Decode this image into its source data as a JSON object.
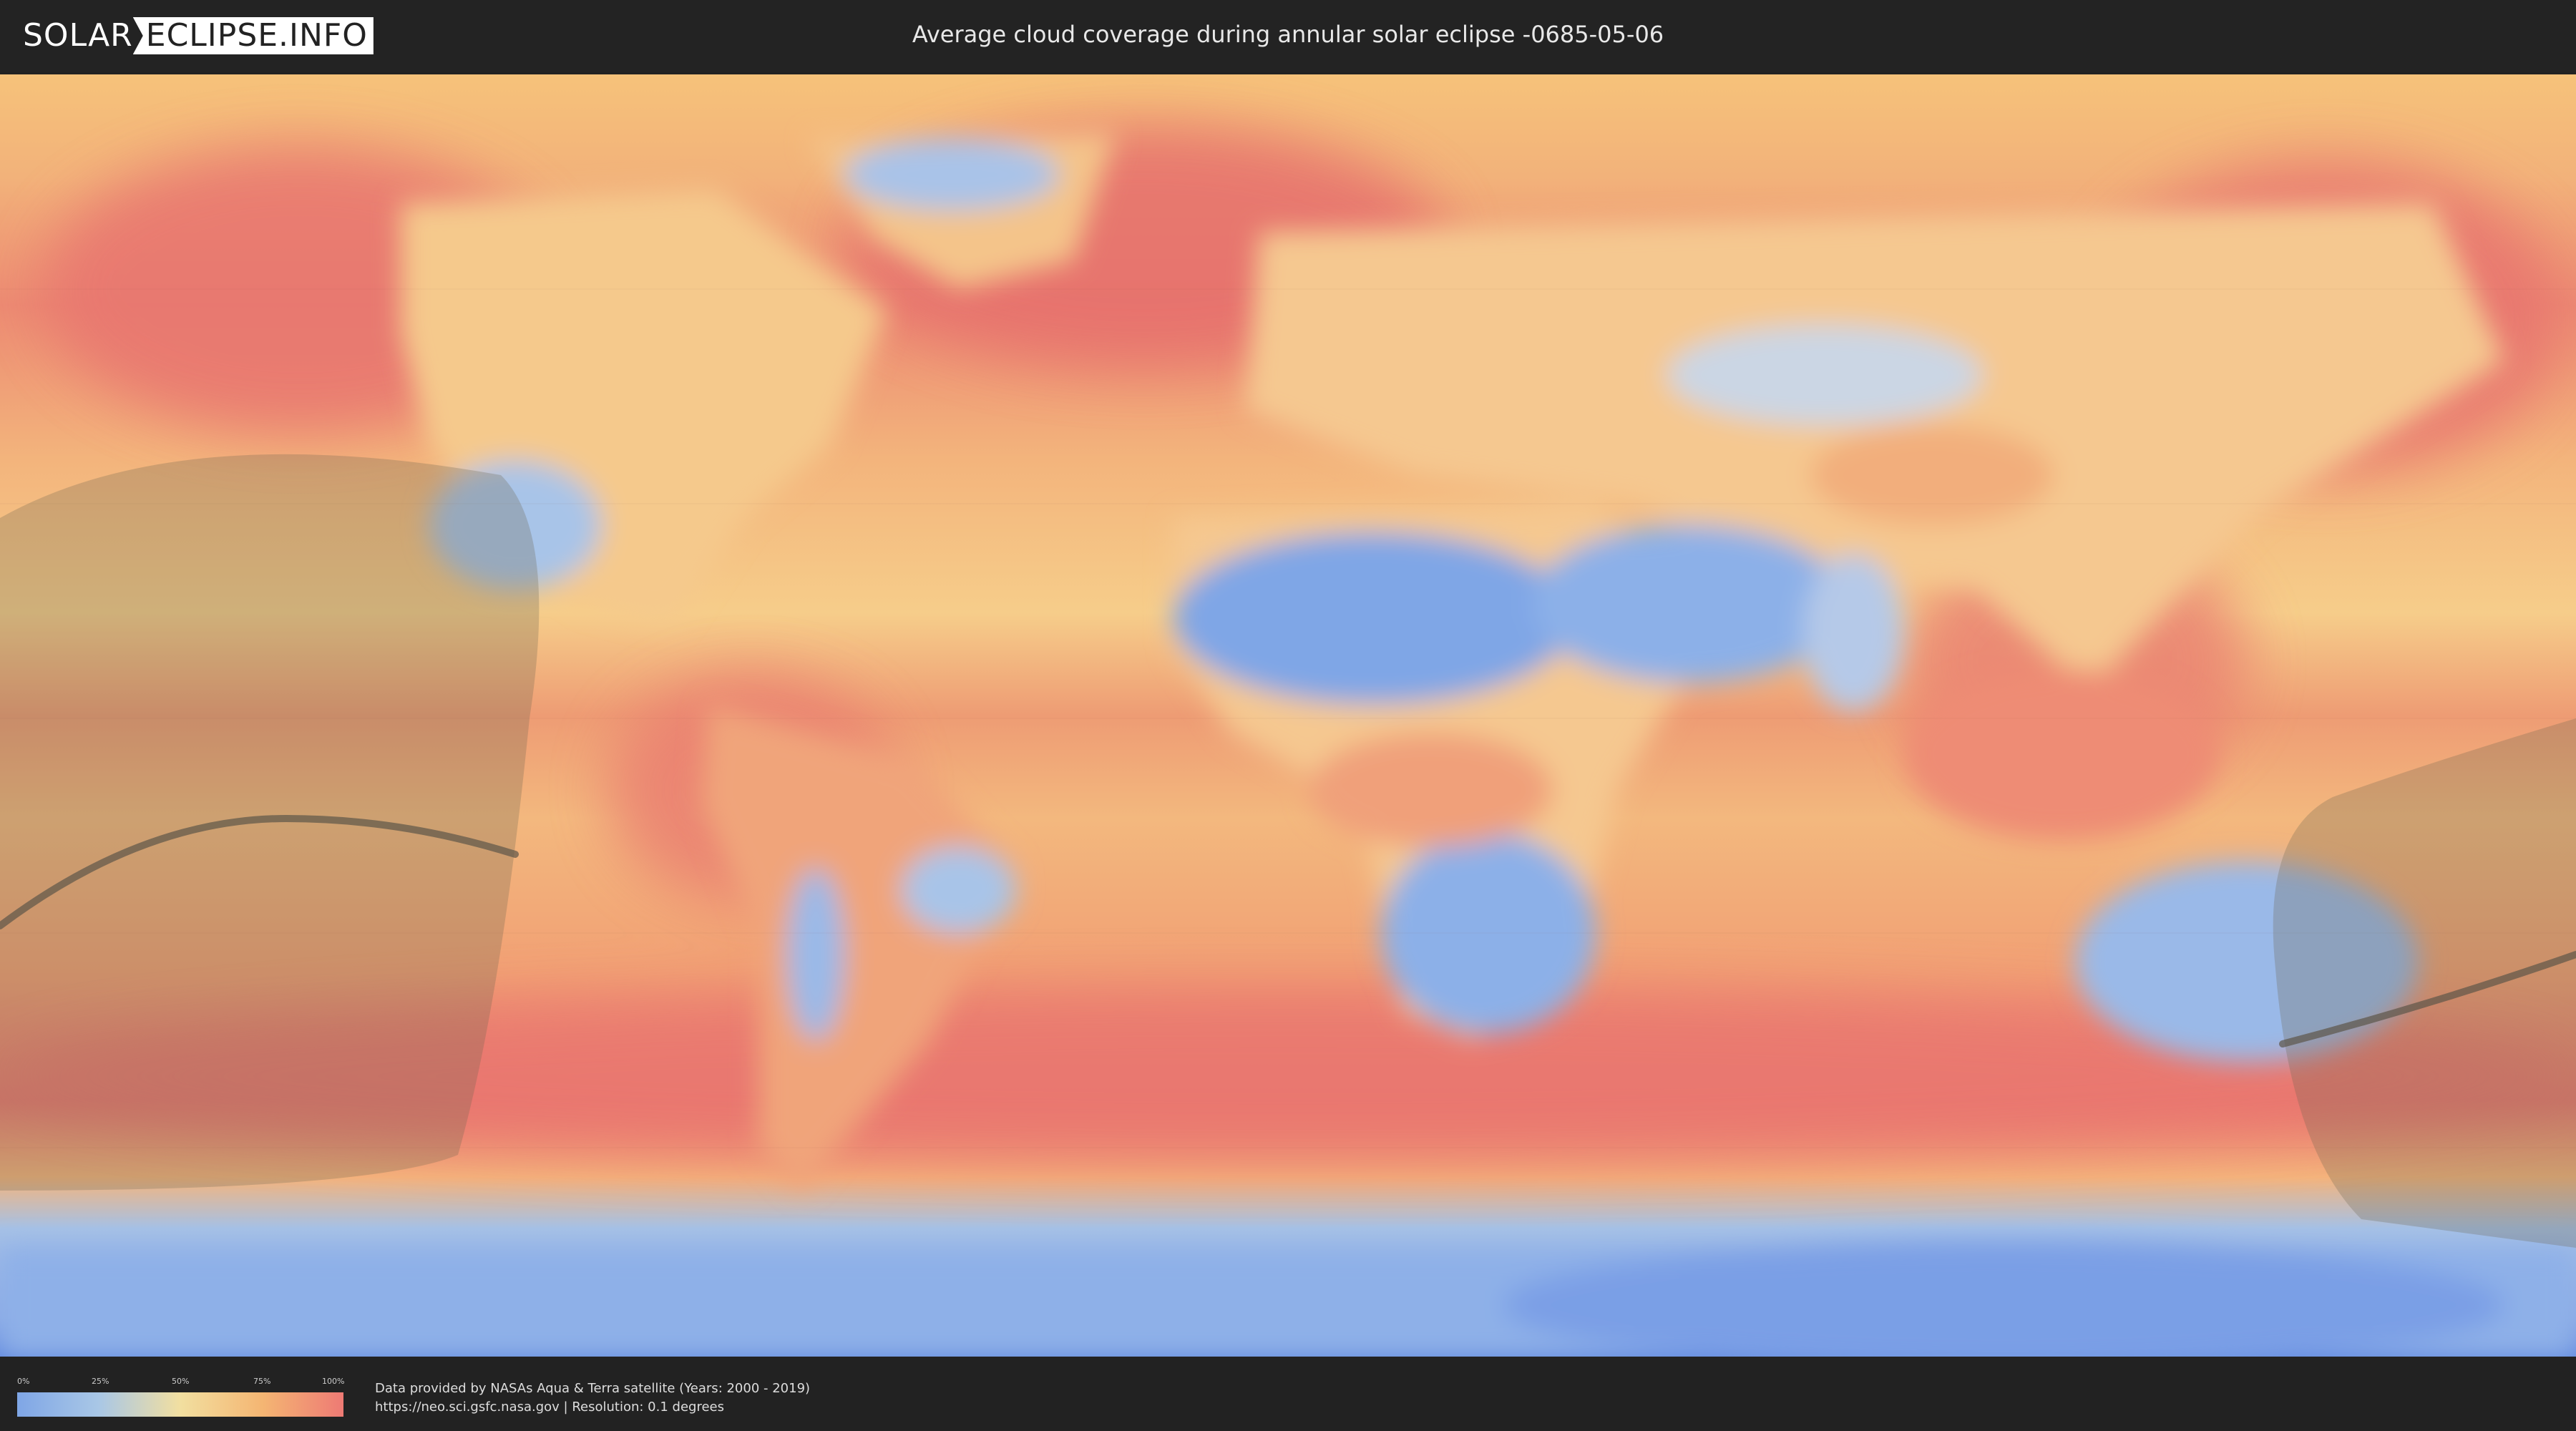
{
  "header": {
    "logo": {
      "part1": "SOLAR",
      "part2": "ECLIPSE.INFO"
    },
    "title": "Average cloud coverage during annular solar eclipse -0685-05-06"
  },
  "map": {
    "layer": "average cloud coverage",
    "colors": {
      "clear": "#7fa6e6",
      "low": "#a9c7e6",
      "mid": "#f2dfa0",
      "high": "#f4b673",
      "overcast": "#ee7a74",
      "eclipse_shadow": "#4a4a3a"
    }
  },
  "legend": {
    "ticks": [
      "0%",
      "25%",
      "50%",
      "75%",
      "100%"
    ]
  },
  "footer": {
    "credit_line1": "Data provided by NASAs Aqua & Terra satellite (Years: 2000 - 2019)",
    "credit_line2": "https://neo.sci.gsfc.nasa.gov | Resolution: 0.1 degrees"
  }
}
